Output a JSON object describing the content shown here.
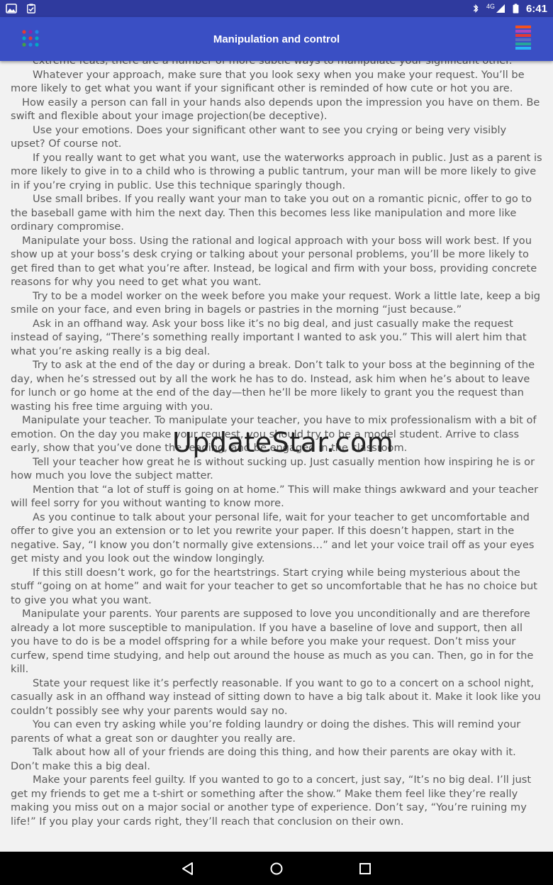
{
  "status_bar": {
    "time": "6:41",
    "network": "4G",
    "icons": [
      "gallery-icon",
      "clipboard-check-icon",
      "bluetooth-icon",
      "signal-icon",
      "battery-icon"
    ]
  },
  "app_bar": {
    "title": "Manipulation and control",
    "left_icon": "grid-dots-icon",
    "right_icon": "stacked-layers-icon",
    "colors": {
      "bar": "#3a4fc4",
      "status": "#2f3a9e"
    }
  },
  "article": {
    "paragraphs": [
      {
        "text": "extreme feats, there are a number of more subtle ways to manipulate your significant other.",
        "indent": "normal"
      },
      {
        "text": "Whatever your approach, make sure that you look sexy when you make your request. You’ll be more likely to get what you want if your significant other is reminded of how cute or hot you are.",
        "indent": "normal"
      },
      {
        "text": "How easily a person can fall in your hands also depends upon the impression you have on them. Be swift and flexible about your image projection(be deceptive).",
        "indent": "heading"
      },
      {
        "text": "Use your emotions. Does your significant other want to see you crying or being very visibly upset? Of course not.",
        "indent": "normal"
      },
      {
        "text": "If you really want to get what you want, use the waterworks approach in public. Just as a parent is more likely to give in to a child who is throwing a public tantrum, your man will be more likely to give in if you’re crying in public. Use this technique sparingly though.",
        "indent": "normal"
      },
      {
        "text": "Use small bribes. If you really want your man to take you out on a romantic picnic, offer to go to the baseball game with him the next day. Then this becomes less like manipulation and more like ordinary compromise.",
        "indent": "normal"
      },
      {
        "text": "Manipulate your boss. Using the rational and logical approach with your boss will work best. If you show up at your boss’s desk crying or talking about your personal problems, you’ll be more likely to get fired than to get what you’re after. Instead, be logical and firm with your boss, providing concrete reasons for why you need to get what you want.",
        "indent": "heading"
      },
      {
        "text": "Try to be a model worker on the week before you make your request. Work a little late, keep a big smile on your face, and even bring in bagels or pastries in the morning “just because.”",
        "indent": "normal"
      },
      {
        "text": "Ask in an offhand way. Ask your boss like it’s no big deal, and just casually make the request instead of saying, “There’s something really important I wanted to ask you.” This will alert him that what you’re asking really is a big deal.",
        "indent": "normal"
      },
      {
        "text": "Try to ask at the end of the day or during a break. Don’t talk to your boss at the beginning of the day, when he’s stressed out by all the work he has to do. Instead, ask him when he’s about to leave for lunch or go home at the end of the day—then he’ll be more likely to grant you the request than wasting his free time arguing with you.",
        "indent": "normal"
      },
      {
        "text": "Manipulate your teacher. To manipulate your teacher, you have to mix professionalism with a bit of emotion. On the day you make your request, you should try to be a model student. Arrive to class early, show that you’ve done the reading, and be engaged in the classroom.",
        "indent": "heading"
      },
      {
        "text": "Tell your teacher how great he is without sucking up. Just casually mention how inspiring he is or how much you love the subject matter.",
        "indent": "normal"
      },
      {
        "text": "Mention that “a lot of stuff is going on at home.” This will make things awkward and your teacher will feel sorry for you without wanting to know more.",
        "indent": "normal"
      },
      {
        "text": "As you continue to talk about your personal life, wait for your teacher to get uncomfortable and offer to give you an extension or to let you rewrite your paper. If this doesn’t happen, start in the negative. Say, “I know you don’t normally give extensions…” and let your voice trail off as your eyes get misty and you look out the window longingly.",
        "indent": "normal"
      },
      {
        "text": "If this still doesn’t work, go for the heartstrings. Start crying while being mysterious about the stuff “going on at home” and wait for your teacher to get so uncomfortable that he has no choice but to give you what you want.",
        "indent": "normal"
      },
      {
        "text": "Manipulate your parents. Your parents are supposed to love you unconditionally and are therefore already a lot more susceptible to manipulation. If you have a baseline of love and support, then all you have to do is be a model offspring for a while before you make your request. Don’t miss your curfew, spend time studying, and help out around the house as much as you can. Then, go in for the kill.",
        "indent": "heading"
      },
      {
        "text": "State your request like it’s perfectly reasonable. If you want to go to a concert on a school night, casually ask in an offhand way instead of sitting down to have a big talk about it. Make it look like you couldn’t possibly see why your parents would say no.",
        "indent": "normal"
      },
      {
        "text": "You can even try asking while you’re folding laundry or doing the dishes. This will remind your parents of what a great son or daughter you really are.",
        "indent": "normal"
      },
      {
        "text": "Talk about how all of your friends are doing this thing, and how their parents are okay with it. Don’t make this a big deal.",
        "indent": "normal"
      },
      {
        "text": "Make your parents feel guilty. If you wanted to go to a concert, just say, “It’s no big deal. I’ll just get my friends to get me a t-shirt or something after the show.” Make them feel like they’re really making you miss out on a major social or another type of experience. Don’t say, “You’re ruining my life!” If you play your cards right, they’ll reach that conclusion on their own.",
        "indent": "normal"
      }
    ]
  },
  "watermark": "UpdateStar.com",
  "nav_bar": {
    "buttons": [
      "back-icon",
      "home-icon",
      "recents-icon"
    ]
  }
}
